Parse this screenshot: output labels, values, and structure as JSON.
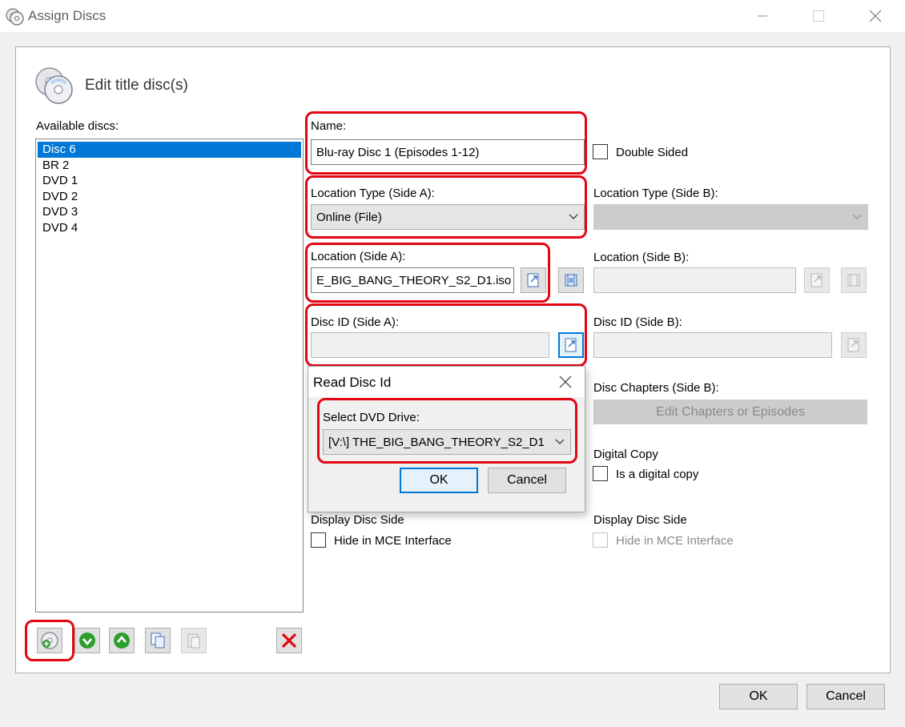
{
  "window": {
    "title": "Assign Discs"
  },
  "header": {
    "title": "Edit title disc(s)"
  },
  "available_discs": {
    "label": "Available discs:",
    "items": [
      "Disc 6",
      "BR 2",
      "DVD 1",
      "DVD 2",
      "DVD 3",
      "DVD 4"
    ],
    "selected": "Disc 6"
  },
  "fields": {
    "name_label": "Name:",
    "name_value": "Blu-ray Disc 1 (Episodes 1-12)",
    "double_sided_label": "Double Sided",
    "loc_type_a_label": "Location Type (Side A):",
    "loc_type_a_value": "Online (File)",
    "loc_type_b_label": "Location Type (Side B):",
    "location_a_label": "Location (Side A):",
    "location_a_value": "E_BIG_BANG_THEORY_S2_D1.iso",
    "location_b_label": "Location (Side B):",
    "disc_id_a_label": "Disc ID (Side A):",
    "disc_id_b_label": "Disc ID (Side B):",
    "disc_chapters_b_label": "Disc Chapters (Side B):",
    "edit_chapters_label": "Edit Chapters or Episodes",
    "digital_copy_label": "Digital Copy",
    "is_digital_copy_label": "Is a digital copy",
    "display_side_a_label": "Display Disc Side",
    "hide_mce_a_label": "Hide in MCE Interface",
    "display_side_b_label": "Display Disc Side",
    "hide_mce_b_label": "Hide in MCE Interface"
  },
  "popup": {
    "title": "Read Disc Id",
    "drive_label": "Select DVD Drive:",
    "drive_value": "[V:\\] THE_BIG_BANG_THEORY_S2_D1",
    "ok_label": "OK",
    "cancel_label": "Cancel"
  },
  "footer": {
    "ok_label": "OK",
    "cancel_label": "Cancel"
  },
  "icons": {
    "accent": "#0078d7",
    "highlight_red": "#e30613",
    "delete_red": "#e30613",
    "move_green": "#2e9e2e"
  }
}
